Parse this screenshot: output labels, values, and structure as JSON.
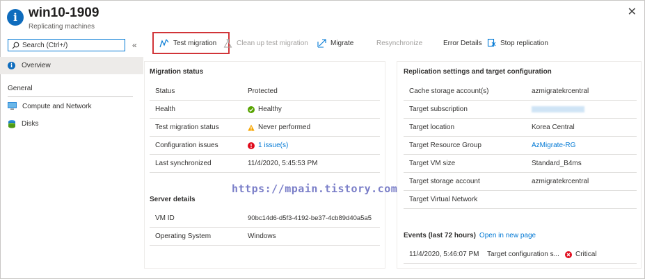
{
  "header": {
    "title": "win10-1909",
    "subtitle": "Replicating machines"
  },
  "sidebar": {
    "search_placeholder": "Search (Ctrl+/)",
    "collapse_glyph": "«",
    "overview_label": "Overview",
    "section_label": "General",
    "items": [
      {
        "label": "Compute and Network",
        "icon": "monitor-icon"
      },
      {
        "label": "Disks",
        "icon": "disks-icon"
      }
    ]
  },
  "toolbar": {
    "test_migration": "Test migration",
    "clean_up": "Clean up test migration",
    "migrate": "Migrate",
    "resynchronize": "Resynchronize",
    "error_details": "Error Details",
    "stop_replication": "Stop replication"
  },
  "migration_status": {
    "title": "Migration status",
    "rows": [
      {
        "label": "Status",
        "value": "Protected"
      },
      {
        "label": "Health",
        "value": "Healthy"
      },
      {
        "label": "Test migration status",
        "value": "Never performed"
      },
      {
        "label": "Configuration issues",
        "value": "1 issue(s)"
      },
      {
        "label": "Last synchronized",
        "value": "11/4/2020, 5:45:53 PM"
      }
    ]
  },
  "server_details": {
    "title": "Server details",
    "rows": [
      {
        "label": "VM ID",
        "value": "90bc14d6-d5f3-4192-be37-4cb89d40a5a5"
      },
      {
        "label": "Operating System",
        "value": "Windows"
      }
    ]
  },
  "replication": {
    "title": "Replication settings and target configuration",
    "rows": [
      {
        "label": "Cache storage account(s)",
        "value": "azmigratekrcentral"
      },
      {
        "label": "Target subscription",
        "value": ""
      },
      {
        "label": "Target location",
        "value": "Korea Central"
      },
      {
        "label": "Target Resource Group",
        "value": "AzMigrate-RG"
      },
      {
        "label": "Target VM size",
        "value": "Standard_B4ms"
      },
      {
        "label": "Target storage account",
        "value": "azmigratekrcentral"
      },
      {
        "label": "Target Virtual Network",
        "value": ""
      }
    ]
  },
  "events": {
    "title": "Events (last 72 hours)",
    "link": "Open in new page",
    "rows": [
      {
        "time": "11/4/2020, 5:46:07 PM",
        "name": "Target configuration s...",
        "severity": "Critical"
      }
    ]
  },
  "watermark": "https://mpain.tistory.com",
  "colors": {
    "accent": "#0078d4",
    "healthy": "#57a300",
    "warning": "#f7a600",
    "error": "#e00b1c",
    "highlight": "#d13438"
  }
}
